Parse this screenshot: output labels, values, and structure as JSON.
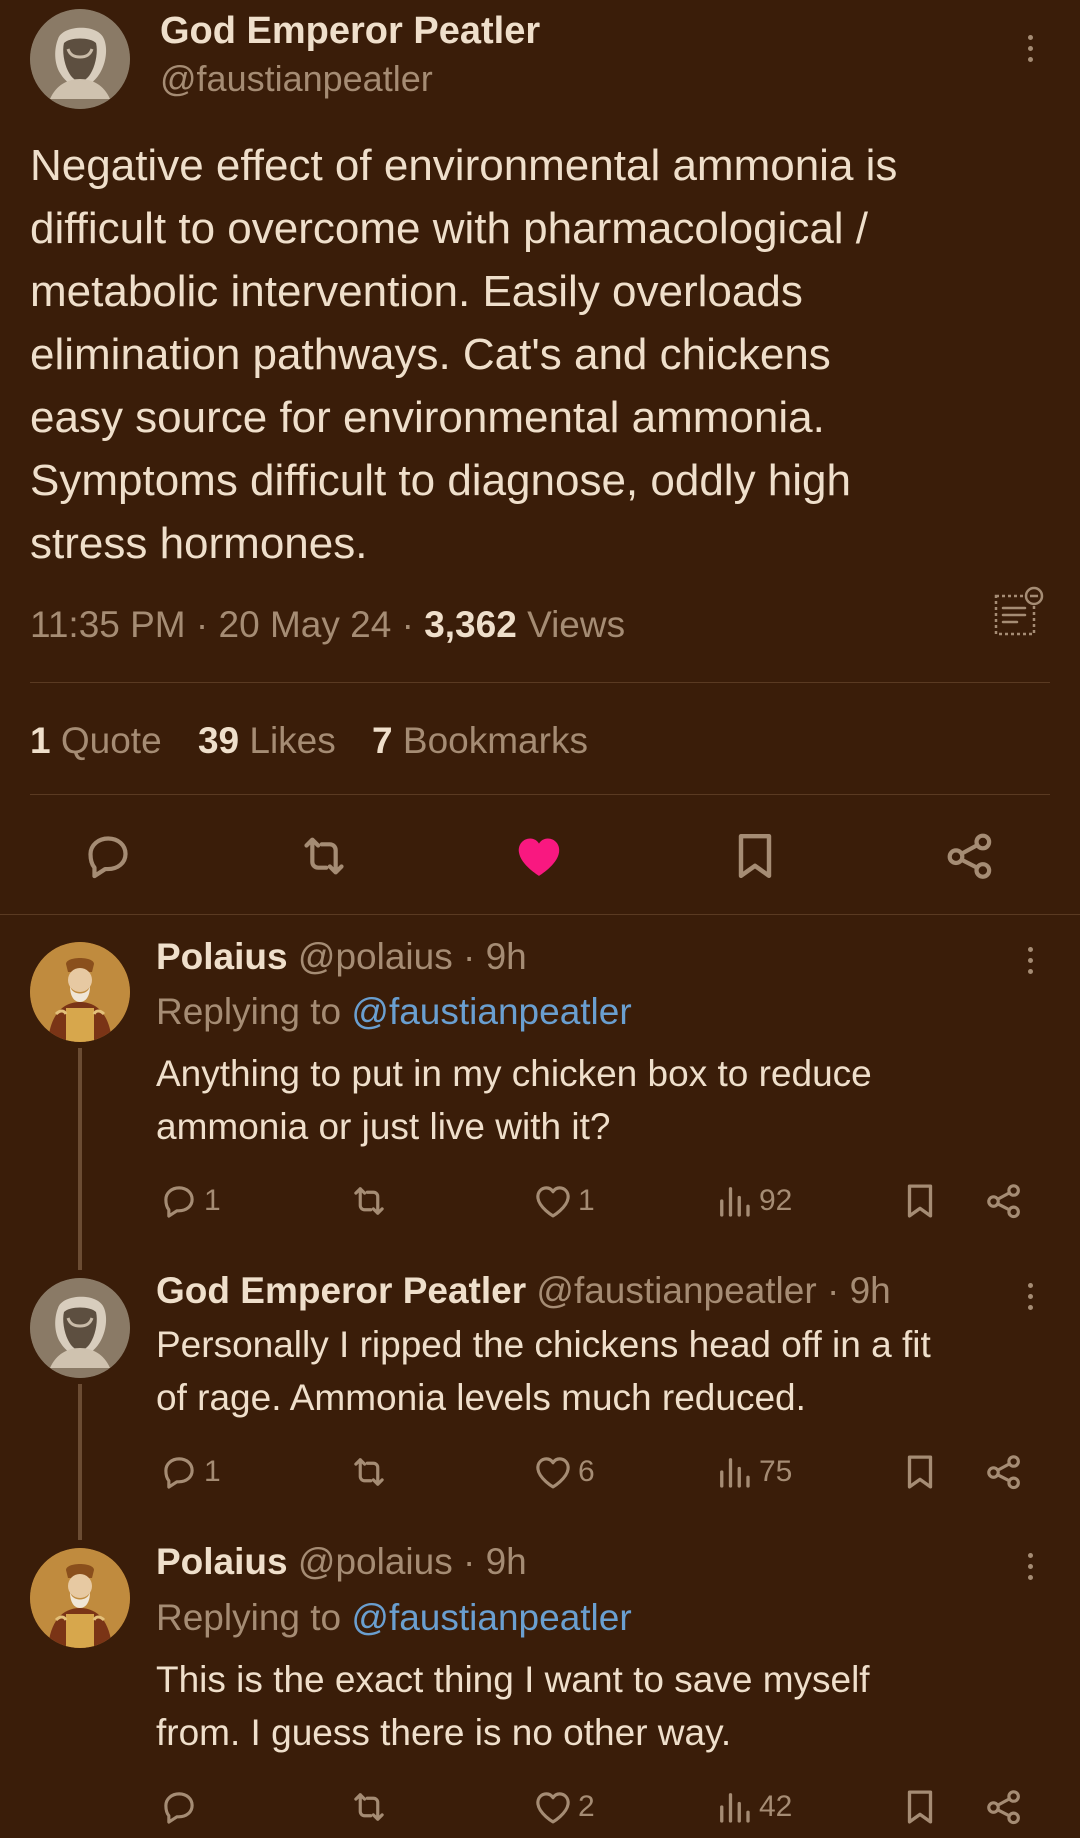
{
  "main_tweet": {
    "author_name": "God Emperor Peatler",
    "author_handle": "@faustianpeatler",
    "text": "Negative effect of environmental ammonia is\ndifficult to overcome with pharmacological /\nmetabolic intervention. Easily overloads\nelimination pathways. Cat's and chickens\neasy source for environmental ammonia.\nSymptoms difficult to diagnose, oddly high\nstress hormones.",
    "time": "11:35 PM",
    "sep": "·",
    "date": "20 May 24",
    "views_count": "3,362",
    "views_label": "Views",
    "quotes_count": "1",
    "quotes_label": "Quote",
    "likes_count": "39",
    "likes_label": "Likes",
    "bookmarks_count": "7",
    "bookmarks_label": "Bookmarks",
    "liked": true
  },
  "replies": [
    {
      "author_name": "Polaius",
      "author_handle": "@polaius",
      "time": "· 9h",
      "replying_prefix": "Replying to",
      "replying_handle": "@faustianpeatler",
      "text": "Anything to put in my chicken box to reduce\nammonia or just live with it?",
      "reply_count": "1",
      "retweet_count": "",
      "like_count": "1",
      "view_count": "92"
    },
    {
      "author_name": "God Emperor Peatler",
      "author_handle": "@faustianpeatler",
      "time": "· 9h",
      "text": "Personally I ripped the chickens head off in a fit\nof rage. Ammonia levels much reduced.",
      "reply_count": "1",
      "retweet_count": "",
      "like_count": "6",
      "view_count": "75"
    },
    {
      "author_name": "Polaius",
      "author_handle": "@polaius",
      "time": "· 9h",
      "replying_prefix": "Replying to",
      "replying_handle": "@faustianpeatler",
      "text": "This is the exact thing I want to save myself\nfrom. I guess there is no other way.",
      "reply_count": "",
      "retweet_count": "",
      "like_count": "2",
      "view_count": "42"
    }
  ],
  "colors": {
    "background": "#3a1d09",
    "text": "#efdfcb",
    "muted": "#a58c74",
    "link": "#6a9fd0",
    "like_active": "#f91880"
  },
  "icons": {
    "reply": "comment-bubble-icon",
    "retweet": "retweet-arrows-icon",
    "like": "heart-icon",
    "bookmark": "bookmark-icon",
    "share": "share-nodes-icon",
    "views": "bar-chart-icon",
    "more": "more-vertical-icon",
    "notes": "notes-list-icon"
  }
}
